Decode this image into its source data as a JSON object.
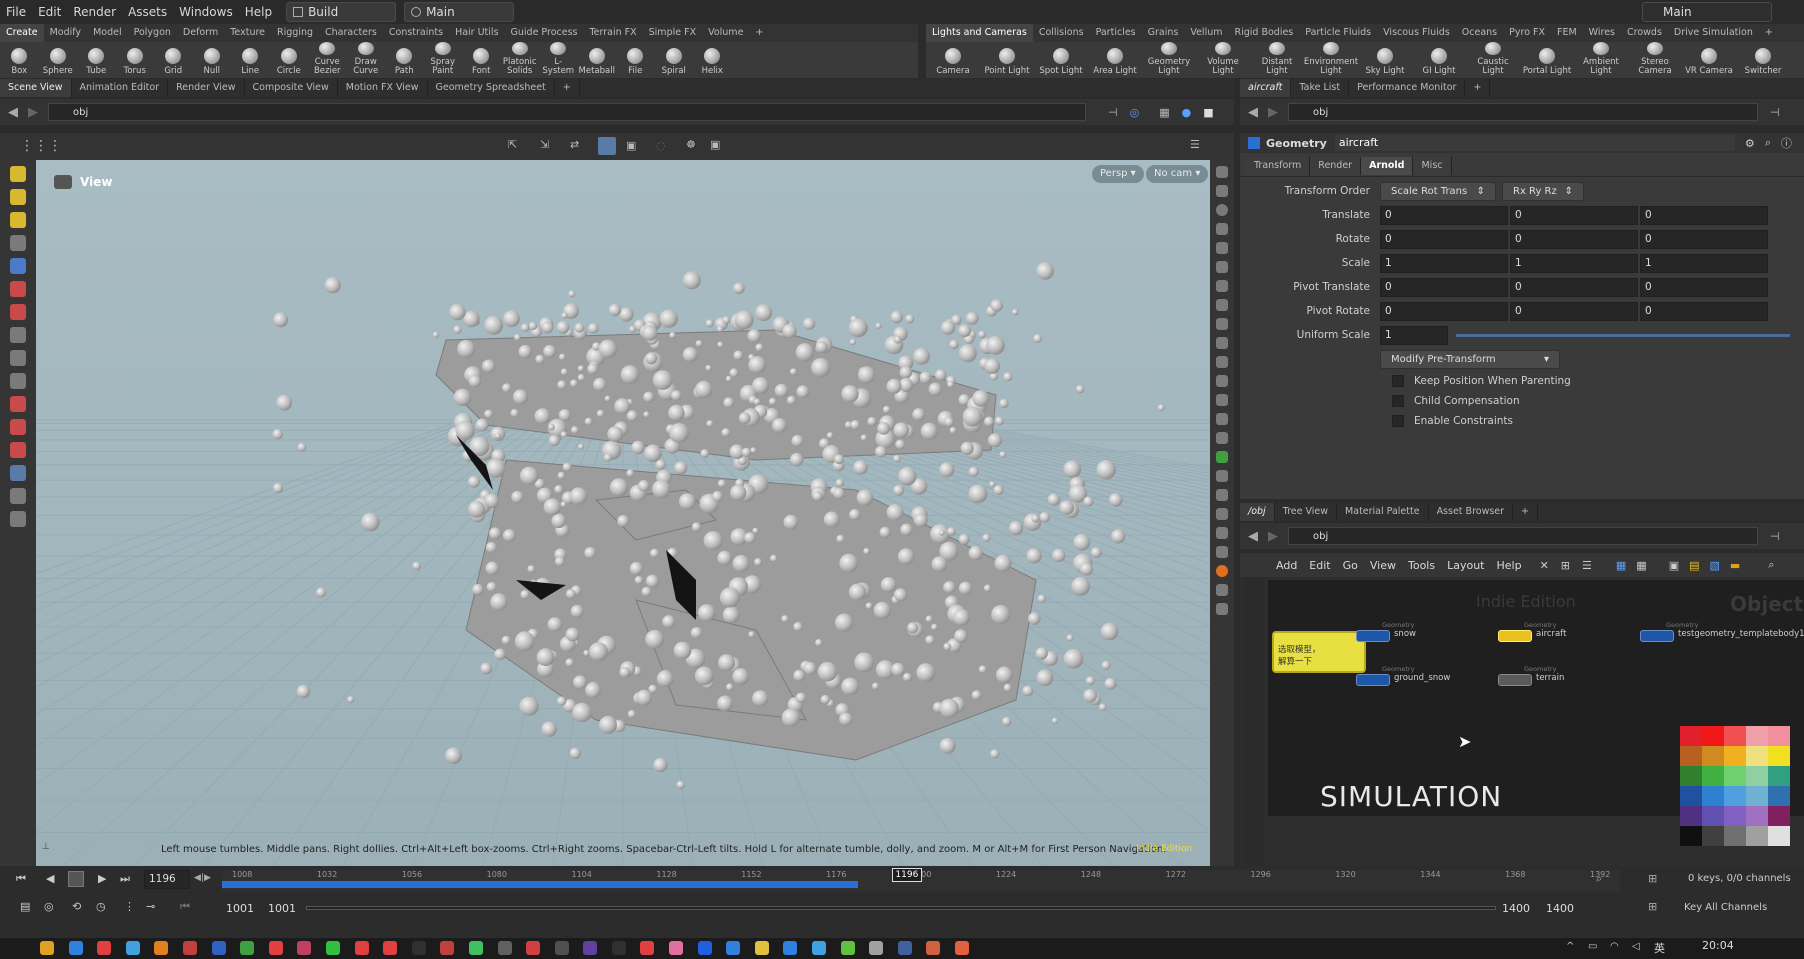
{
  "menubar": {
    "items": [
      "File",
      "Edit",
      "Render",
      "Assets",
      "Windows",
      "Help"
    ],
    "desktop_left": "Build",
    "desktop_center": "Main",
    "desktop_right": "Main"
  },
  "shelf_left": {
    "tabs": [
      "Create",
      "Modify",
      "Model",
      "Polygon",
      "Deform",
      "Texture",
      "Rigging",
      "Characters",
      "Constraints",
      "Hair Utils",
      "Guide Process",
      "Terrain FX",
      "Simple FX",
      "Volume"
    ],
    "tools": [
      "Box",
      "Sphere",
      "Tube",
      "Torus",
      "Grid",
      "Null",
      "Line",
      "Circle",
      "Curve Bezier",
      "Draw Curve",
      "Path",
      "Spray Paint",
      "Font",
      "Platonic Solids",
      "L-System",
      "Metaball",
      "File",
      "Spiral",
      "Helix"
    ]
  },
  "shelf_right": {
    "tabs": [
      "Lights and Cameras",
      "Collisions",
      "Particles",
      "Grains",
      "Vellum",
      "Rigid Bodies",
      "Particle Fluids",
      "Viscous Fluids",
      "Oceans",
      "Pyro FX",
      "FEM",
      "Wires",
      "Crowds",
      "Drive Simulation"
    ],
    "tools": [
      "Camera",
      "Point Light",
      "Spot Light",
      "Area Light",
      "Geometry Light",
      "Volume Light",
      "Distant Light",
      "Environment Light",
      "Sky Light",
      "GI Light",
      "Caustic Light",
      "Portal Light",
      "Ambient Light",
      "Stereo Camera",
      "VR Camera",
      "Switcher"
    ]
  },
  "left_pane": {
    "tabs": [
      "Scene View",
      "Animation Editor",
      "Render View",
      "Composite View",
      "Motion FX View",
      "Geometry Spreadsheet"
    ],
    "path": "obj",
    "viewport_title": "View",
    "persp_label": "Persp",
    "cam_label": "No cam",
    "hint": "Left mouse tumbles. Middle pans. Right dollies. Ctrl+Alt+Left box-zooms. Ctrl+Right zooms. Spacebar-Ctrl-Left tilts. Hold L for alternate tumble, dolly, and zoom. M or Alt+M for First Person Navigation.",
    "indie": "Indie Edition"
  },
  "param_pane": {
    "tabs": [
      "aircraft",
      "Take List",
      "Performance Monitor"
    ],
    "path": "obj",
    "node_type": "Geometry",
    "node_name": "aircraft",
    "param_tabs": [
      "Transform",
      "Render",
      "Arnold",
      "Misc"
    ],
    "transform_order_label": "Transform Order",
    "transform_order": "Scale Rot Trans",
    "rot_order": "Rx Ry Rz",
    "rows": [
      {
        "label": "Translate",
        "values": [
          "0",
          "0",
          "0"
        ]
      },
      {
        "label": "Rotate",
        "values": [
          "0",
          "0",
          "0"
        ]
      },
      {
        "label": "Scale",
        "values": [
          "1",
          "1",
          "1"
        ]
      },
      {
        "label": "Pivot Translate",
        "values": [
          "0",
          "0",
          "0"
        ]
      },
      {
        "label": "Pivot Rotate",
        "values": [
          "0",
          "0",
          "0"
        ]
      }
    ],
    "uniform_scale_label": "Uniform Scale",
    "uniform_scale": "1",
    "pre_transform": "Modify Pre-Transform",
    "checkboxes": [
      "Keep Position When Parenting",
      "Child Compensation",
      "Enable Constraints"
    ]
  },
  "network_pane": {
    "tabs": [
      "/obj",
      "Tree View",
      "Material Palette",
      "Asset Browser"
    ],
    "path": "obj",
    "menu": [
      "Add",
      "Edit",
      "Go",
      "View",
      "Tools",
      "Layout",
      "Help"
    ],
    "watermark_edition": "Indie Edition",
    "watermark_context": "Object",
    "sticky_note": "选取模型，\n解算一下",
    "node_type": "Geometry",
    "nodes": [
      "snow",
      "aircraft",
      "testgeometry_templatebody1",
      "ground_snow",
      "terrain"
    ],
    "label_overlay": "SIMULATION"
  },
  "timeline": {
    "current_frame": "1196",
    "ticks": [
      "1008",
      "1032",
      "1056",
      "1080",
      "1104",
      "1128",
      "1152",
      "1176",
      "1200",
      "1224",
      "1248",
      "1272",
      "1296",
      "1320",
      "1344",
      "1368",
      "1392"
    ],
    "marker": "1196",
    "keys_info": "0 keys, 0/0 channels",
    "range_start": "1001",
    "range_start2": "1001",
    "range_end": "1400",
    "range_end2": "1400",
    "key_all": "Key All Channels",
    "cached_fraction": 0.455
  },
  "taskbar": {
    "time": "20:04",
    "lang": "英"
  },
  "colors": {
    "accent": "#f0c020",
    "node_blue": "#1f57a8",
    "node_yellow": "#e8c020",
    "cache_blue": "#2a6fd8"
  }
}
